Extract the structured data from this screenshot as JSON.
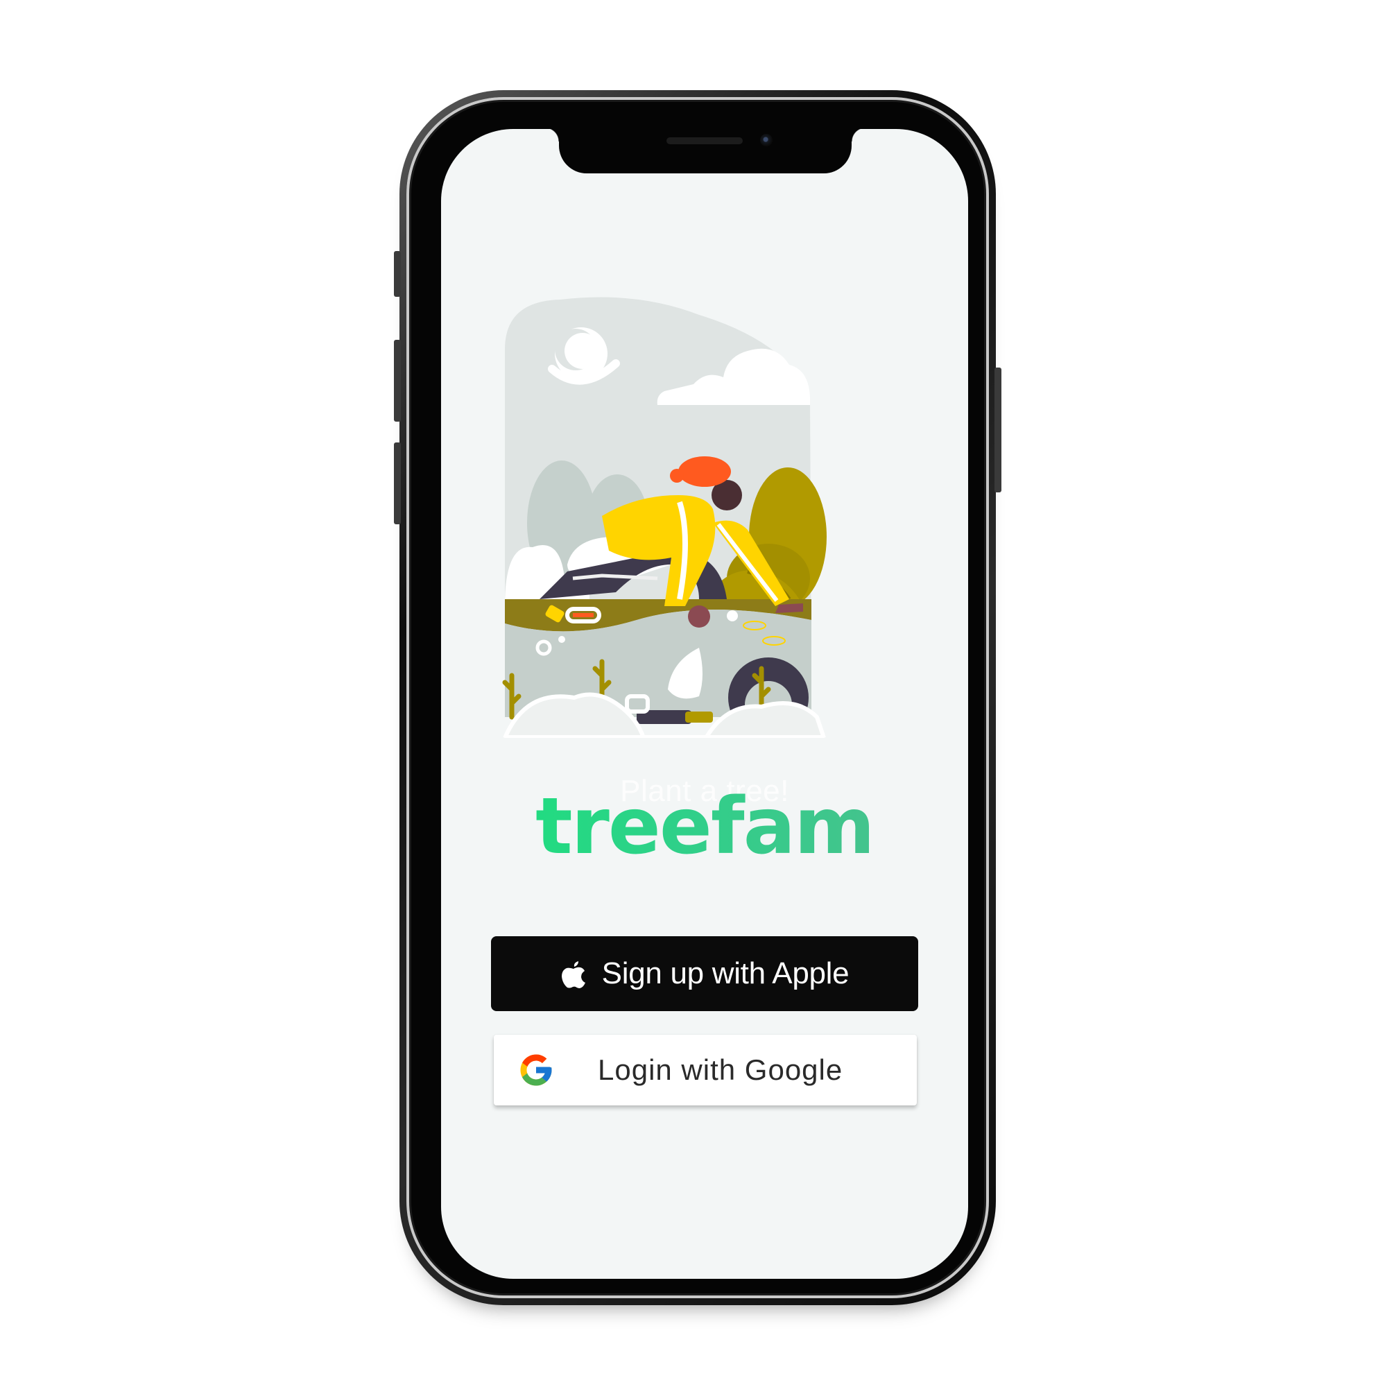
{
  "app": {
    "tagline": "Plant a tree!",
    "logo_text": "treefam"
  },
  "auth": {
    "apple_label": "Sign up with Apple",
    "google_label": "Login with Google"
  },
  "icons": {
    "apple": "apple-icon",
    "google": "google-icon"
  },
  "colors": {
    "screen_background": "#f3f6f6",
    "logo_green_start": "#19e27c",
    "logo_green_end": "#4dbd8f",
    "apple_button": "#0b0b0b",
    "google_button": "#ffffff",
    "illustration_yellow": "#ffd400",
    "illustration_olive": "#b19a00",
    "illustration_orange": "#ff5a1f"
  }
}
